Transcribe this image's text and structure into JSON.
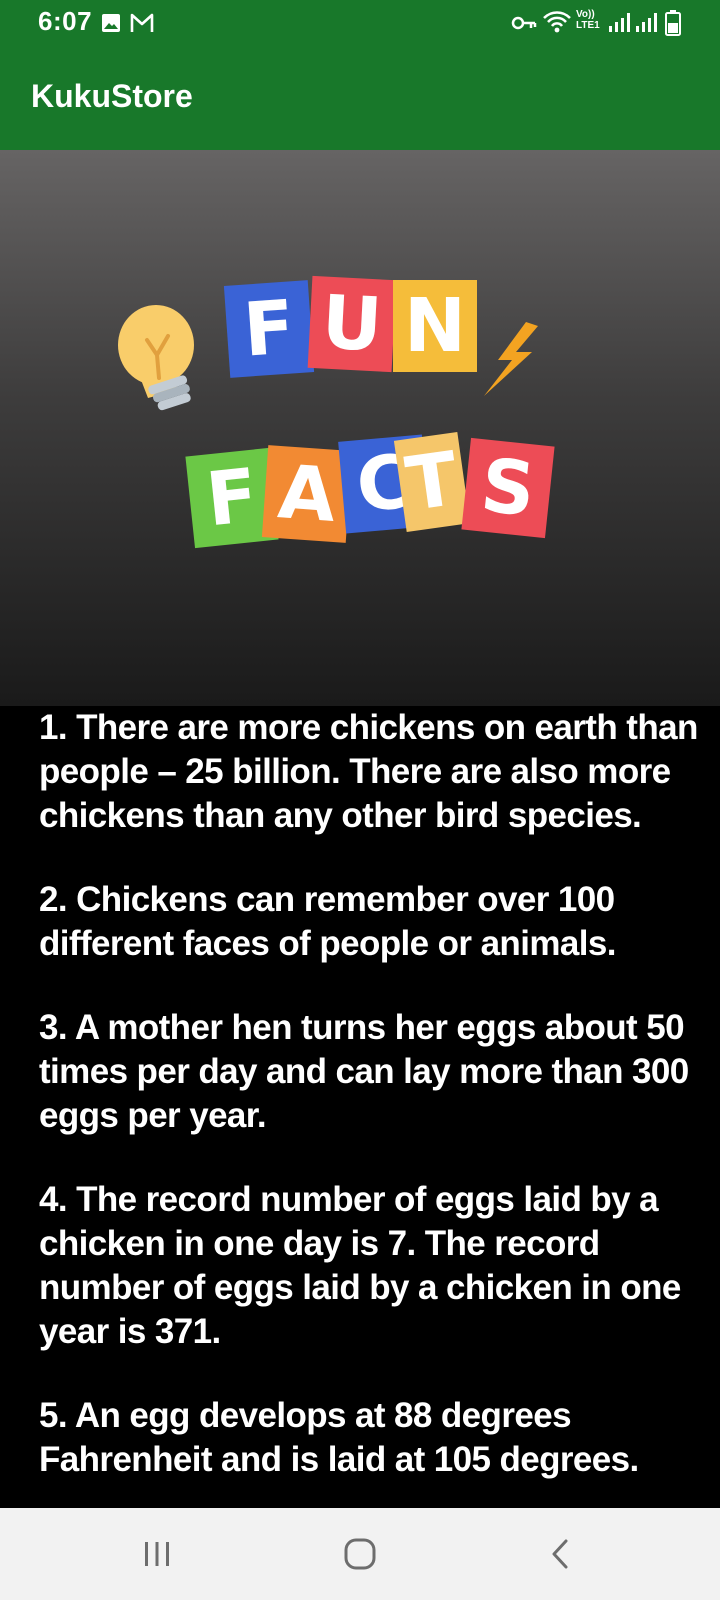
{
  "status_bar": {
    "time": "6:07",
    "left_icons": [
      "image-icon",
      "gmail-icon"
    ],
    "right_icons": [
      "vpn-key-icon",
      "wifi-icon",
      "volte-icon",
      "signal-icon",
      "signal-icon",
      "battery-icon"
    ],
    "volte_top": "Vo))",
    "volte_bottom": "LTE1",
    "background": "#18782a"
  },
  "app_bar": {
    "title": "KukuStore",
    "color": "#18782a"
  },
  "banner": {
    "word1": [
      "F",
      "U",
      "N"
    ],
    "word2": [
      "F",
      "A",
      "C",
      "T",
      "S"
    ],
    "icons": [
      "lightbulb-icon",
      "lightning-icon"
    ]
  },
  "facts": [
    "1. There are more chickens on earth than people – 25 billion. There are also more chickens than any other bird species.",
    "2. Chickens can remember over 100 different faces of people or animals.",
    "3. A mother hen turns her eggs about 50 times per day and can lay more than 300 eggs per year.",
    "4. The record number of eggs laid by a chicken in one day is 7. The record number of eggs laid by a chicken in one year is 371.",
    "5. An egg develops at 88 degrees Fahrenheit and is laid at 105 degrees."
  ],
  "nav_bar": {
    "buttons": [
      "recent-apps-icon",
      "home-icon",
      "back-icon"
    ]
  }
}
